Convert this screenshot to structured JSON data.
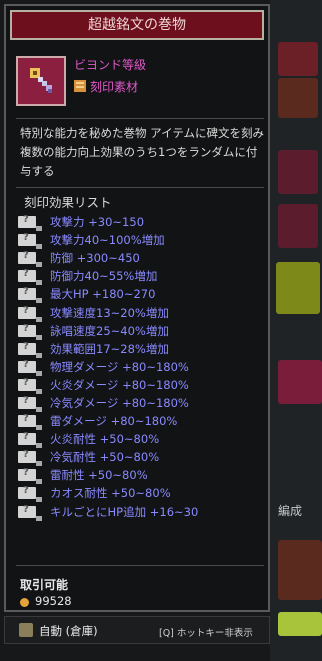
{
  "tooltip": {
    "title": "超越銘文の巻物",
    "grade": "ビヨンド等級",
    "material_label": "刻印素材",
    "description": "特別な能力を秘めた巻物 アイテムに碑文を刻み 複数の能力向上効果のうち1つをランダムに付与する",
    "list_heading": "刻印効果リスト",
    "effects": [
      "攻撃力 +30~150",
      "攻撃力40~100%増加",
      "防御 +300~450",
      "防御力40~55%増加",
      "最大HP +180~270",
      "攻撃速度13~20%増加",
      "詠唱速度25~40%増加",
      "効果範囲17~28%増加",
      "物理ダメージ +80~180%",
      "火炎ダメージ +80~180%",
      "冷気ダメージ +80~180%",
      "雷ダメージ +80~180%",
      "火炎耐性 +50~80%",
      "冷気耐性 +50~80%",
      "雷耐性 +50~80%",
      "カオス耐性 +50~80%",
      "キルごとにHP追加 +16~30"
    ],
    "tradeable_label": "取引可能",
    "price": "99528"
  },
  "footer": {
    "auto_label": "自動 (倉庫)",
    "hotkey_label": "[Q] ホットキー非表示"
  },
  "background": {
    "side_label": "編成"
  },
  "colors": {
    "title_bg": "#6e0f1d",
    "grade_text": "#e059c8",
    "effect_text": "#8a8aff",
    "coin": "#e6a33a"
  }
}
